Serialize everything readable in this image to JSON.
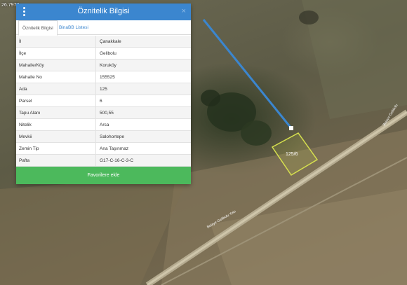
{
  "map": {
    "coordinate_readout": "26.7977",
    "parcel_label": "125/6",
    "road_label_upper": "Bolayır-Gelibolu",
    "road_label_lower": "Bolayır-Gelibolu Yolu"
  },
  "panel": {
    "title": "Öznitelik Bilgisi",
    "tabs": [
      {
        "label": "Öznitelik Bilgisi"
      },
      {
        "label": "BinaBB Listesi"
      }
    ],
    "rows": [
      {
        "key": "İl",
        "value": "Çanakkale"
      },
      {
        "key": "İlçe",
        "value": "Gelibolu"
      },
      {
        "key": "Mahalle/Köy",
        "value": "Koruköy"
      },
      {
        "key": "Mahalle No",
        "value": "155525"
      },
      {
        "key": "Ada",
        "value": "125"
      },
      {
        "key": "Parsel",
        "value": "6"
      },
      {
        "key": "Tapu Alanı",
        "value": "500,55"
      },
      {
        "key": "Nitelik",
        "value": "Arsa"
      },
      {
        "key": "Mevkii",
        "value": "Salohortepe"
      },
      {
        "key": "Zemin Tip",
        "value": "Ana Taşınmaz"
      },
      {
        "key": "Pafta",
        "value": "G17-C-16-C-3-C"
      }
    ],
    "favorite_button": "Favorilere ekle"
  }
}
